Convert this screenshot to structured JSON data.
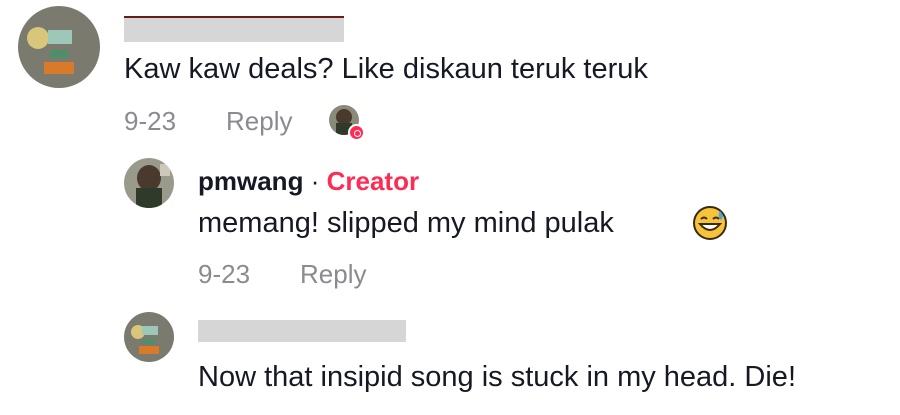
{
  "comments": [
    {
      "author": "",
      "text": "Kaw kaw deals? Like diskaun teruk teruk",
      "date": "9-23",
      "reply_label": "Reply",
      "liked_by_creator_icon": "creator-heart-avatar-icon"
    },
    {
      "author": "pmwang",
      "separator": "·",
      "badge": "Creator",
      "text": "memang!  slipped my mind pulak",
      "emoji_icon": "grinning-sweat-emoji-icon",
      "date": "9-23",
      "reply_label": "Reply"
    },
    {
      "author": "",
      "text": "Now that insipid song is stuck in my head. Die!"
    }
  ],
  "colors": {
    "text": "#161823",
    "meta": "#8a8b91",
    "creator_badge": "#fe2c55",
    "redaction": "#d6d6d6"
  }
}
